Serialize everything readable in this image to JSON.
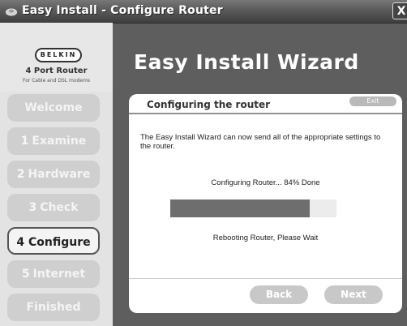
{
  "window": {
    "title": "Easy Install - Configure Router",
    "close_label": "X"
  },
  "sidebar": {
    "brand": "BELKIN",
    "product_name": "4 Port Router",
    "product_sub": "For Cable and DSL modems",
    "steps": [
      {
        "num": "",
        "label": "Welcome",
        "active": false
      },
      {
        "num": "1",
        "label": "Examine",
        "active": false
      },
      {
        "num": "2",
        "label": "Hardware",
        "active": false
      },
      {
        "num": "3",
        "label": "Check",
        "active": false
      },
      {
        "num": "",
        "label": "4 Configure",
        "active": true
      },
      {
        "num": "5",
        "label": "Internet",
        "active": false
      },
      {
        "num": "",
        "label": "Finished",
        "active": false
      }
    ]
  },
  "main": {
    "title": "Easy Install Wizard",
    "panel": {
      "title": "Configuring the router",
      "exit_label": "Exit",
      "description": "The Easy Install Wizard can now send all of the appropriate settings to the router.",
      "progress_label": "Configuring Router... 84% Done",
      "progress_percent": 84,
      "status": "Rebooting Router, Please Wait",
      "back_label": "Back",
      "next_label": "Next"
    }
  },
  "colors": {
    "accent_dark": "#5e5e5e",
    "progress_fill": "#6e6e6e"
  }
}
